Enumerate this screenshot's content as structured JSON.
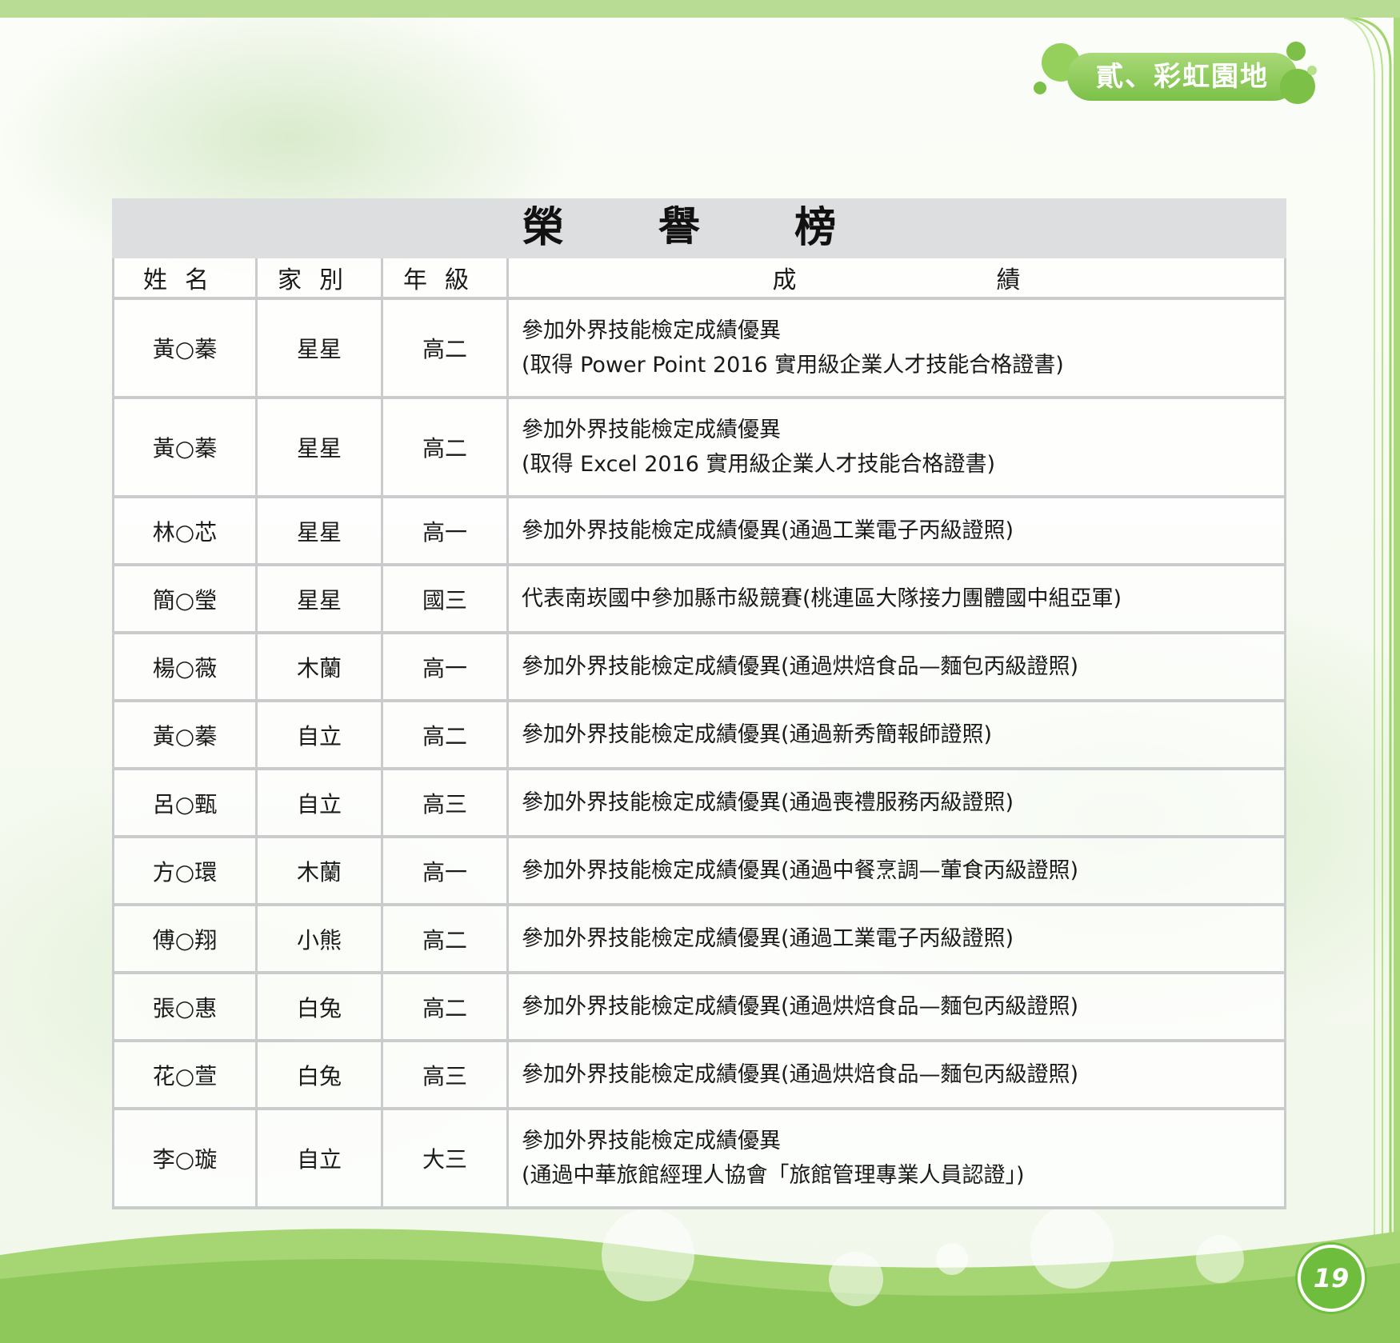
{
  "section_tag": "貳、彩虹園地",
  "page_number": "19",
  "table": {
    "title": "榮 譽 榜",
    "headers": [
      "姓名",
      "家別",
      "年級",
      "成",
      "績"
    ],
    "rows": [
      {
        "name": "黃○蓁",
        "house": "星星",
        "grade": "高二",
        "achievement": [
          "參加外界技能檢定成績優異",
          "(取得 Power Point 2016 實用級企業人才技能合格證書)"
        ]
      },
      {
        "name": "黃○蓁",
        "house": "星星",
        "grade": "高二",
        "achievement": [
          "參加外界技能檢定成績優異",
          "(取得 Excel 2016 實用級企業人才技能合格證書)"
        ]
      },
      {
        "name": "林○芯",
        "house": "星星",
        "grade": "高一",
        "achievement": [
          "參加外界技能檢定成績優異(通過工業電子丙級證照)"
        ]
      },
      {
        "name": "簡○瑩",
        "house": "星星",
        "grade": "國三",
        "achievement": [
          "代表南崁國中參加縣市級競賽(桃連區大隊接力團體國中組亞軍)"
        ]
      },
      {
        "name": "楊○薇",
        "house": "木蘭",
        "grade": "高一",
        "achievement": [
          "參加外界技能檢定成績優異(通過烘焙食品—麵包丙級證照)"
        ]
      },
      {
        "name": "黃○蓁",
        "house": "自立",
        "grade": "高二",
        "achievement": [
          "參加外界技能檢定成績優異(通過新秀簡報師證照)"
        ]
      },
      {
        "name": "呂○甄",
        "house": "自立",
        "grade": "高三",
        "achievement": [
          "參加外界技能檢定成績優異(通過喪禮服務丙級證照)"
        ]
      },
      {
        "name": "方○環",
        "house": "木蘭",
        "grade": "高一",
        "achievement": [
          "參加外界技能檢定成績優異(通過中餐烹調—葷食丙級證照)"
        ]
      },
      {
        "name": "傅○翔",
        "house": "小熊",
        "grade": "高二",
        "achievement": [
          "參加外界技能檢定成績優異(通過工業電子丙級證照)"
        ]
      },
      {
        "name": "張○惠",
        "house": "白兔",
        "grade": "高二",
        "achievement": [
          "參加外界技能檢定成績優異(通過烘焙食品—麵包丙級證照)"
        ]
      },
      {
        "name": "花○萱",
        "house": "白兔",
        "grade": "高三",
        "achievement": [
          "參加外界技能檢定成績優異(通過烘焙食品—麵包丙級證照)"
        ]
      },
      {
        "name": "李○璇",
        "house": "自立",
        "grade": "大三",
        "achievement": [
          "參加外界技能檢定成績優異",
          "(通過中華旅館經理人協會「旅館管理專業人員認證」)"
        ]
      }
    ]
  },
  "colors": {
    "accent_green": "#7cc048",
    "title_bar_gray": "#dcdee0",
    "border_gray": "#c9cbcd"
  }
}
